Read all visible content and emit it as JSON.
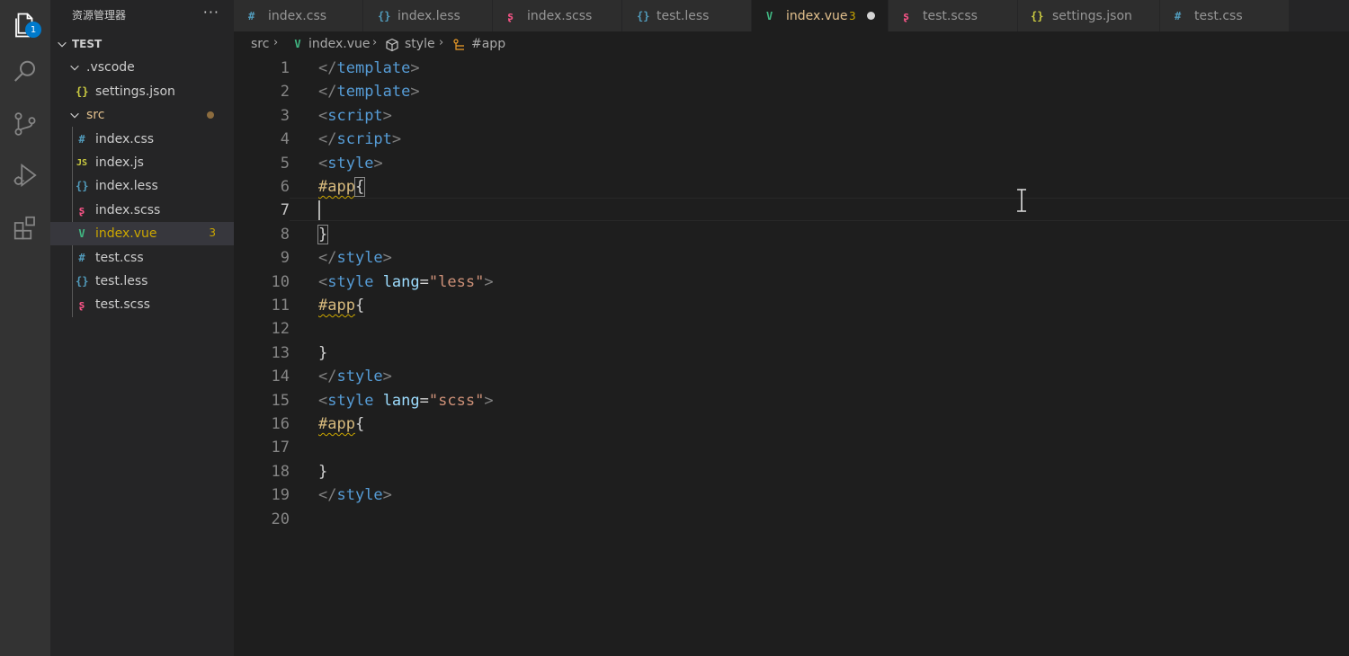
{
  "activity_bar": {
    "explorer_badge": "1",
    "items": [
      "explorer-icon",
      "search-icon",
      "source-control-icon",
      "run-debug-icon",
      "extensions-icon"
    ]
  },
  "sidebar": {
    "title": "资源管理器",
    "more": "···",
    "root": "TEST",
    "tree": [
      {
        "label": ".vscode",
        "icon": "",
        "kind": "folder"
      },
      {
        "label": "settings.json",
        "icon": "{}",
        "kind": "file"
      },
      {
        "label": "src",
        "icon": "",
        "kind": "folder"
      },
      {
        "label": "index.css",
        "icon": "#",
        "kind": "file"
      },
      {
        "label": "index.js",
        "icon": "JS",
        "kind": "file"
      },
      {
        "label": "index.less",
        "icon": "{}",
        "kind": "file"
      },
      {
        "label": "index.scss",
        "icon": "ʂ",
        "kind": "file"
      },
      {
        "label": "index.vue",
        "icon": "V",
        "kind": "file",
        "problems": "3"
      },
      {
        "label": "test.css",
        "icon": "#",
        "kind": "file"
      },
      {
        "label": "test.less",
        "icon": "{}",
        "kind": "file"
      },
      {
        "label": "test.scss",
        "icon": "ʂ",
        "kind": "file"
      }
    ]
  },
  "tabs": [
    {
      "label": "index.css",
      "icon": "#"
    },
    {
      "label": "index.less",
      "icon": "{}"
    },
    {
      "label": "index.scss",
      "icon": "ʂ"
    },
    {
      "label": "test.less",
      "icon": "{}"
    },
    {
      "label": "index.vue",
      "icon": "V",
      "problems": "3",
      "active": true
    },
    {
      "label": "test.scss",
      "icon": "ʂ"
    },
    {
      "label": "settings.json",
      "icon": "{}"
    },
    {
      "label": "test.css",
      "icon": "#"
    }
  ],
  "breadcrumb": [
    "src",
    "index.vue",
    "style",
    "#app"
  ],
  "editor": {
    "line_numbers": [
      "1",
      "2",
      "3",
      "4",
      "5",
      "6",
      "7",
      "8",
      "9",
      "10",
      "11",
      "12",
      "13",
      "14",
      "15",
      "16",
      "17",
      "18",
      "19",
      "20"
    ],
    "lines": [
      [
        [
          "</",
          "br"
        ],
        [
          "template",
          "tag"
        ],
        [
          ">",
          "br"
        ]
      ],
      [
        [
          "</",
          "br"
        ],
        [
          "template",
          "tag"
        ],
        [
          ">",
          "br"
        ]
      ],
      [
        [
          "<",
          "br"
        ],
        [
          "script",
          "tag"
        ],
        [
          ">",
          "br"
        ]
      ],
      [
        [
          "</",
          "br"
        ],
        [
          "script",
          "tag"
        ],
        [
          ">",
          "br"
        ]
      ],
      [
        [
          "<",
          "br"
        ],
        [
          "style",
          "tag"
        ],
        [
          ">",
          "br"
        ]
      ],
      [
        [
          "#app",
          "sel-sq"
        ],
        [
          "{",
          "pun-box"
        ]
      ],
      [],
      [
        [
          "}",
          "pun-box"
        ]
      ],
      [
        [
          "</",
          "br"
        ],
        [
          "style",
          "tag"
        ],
        [
          ">",
          "br"
        ]
      ],
      [
        [
          "<",
          "br"
        ],
        [
          "style",
          "tag"
        ],
        [
          " ",
          "pun"
        ],
        [
          "lang",
          "attr"
        ],
        [
          "=",
          "pun"
        ],
        [
          "\"less\"",
          "str"
        ],
        [
          ">",
          "br"
        ]
      ],
      [
        [
          "#app",
          "sel-sq"
        ],
        [
          "{",
          "pun"
        ]
      ],
      [],
      [
        [
          "}",
          "pun"
        ]
      ],
      [
        [
          "</",
          "br"
        ],
        [
          "style",
          "tag"
        ],
        [
          ">",
          "br"
        ]
      ],
      [
        [
          "<",
          "br"
        ],
        [
          "style",
          "tag"
        ],
        [
          " ",
          "pun"
        ],
        [
          "lang",
          "attr"
        ],
        [
          "=",
          "pun"
        ],
        [
          "\"scss\"",
          "str"
        ],
        [
          ">",
          "br"
        ]
      ],
      [
        [
          "#app",
          "sel-sq"
        ],
        [
          "{",
          "pun"
        ]
      ],
      [],
      [
        [
          "}",
          "pun"
        ]
      ],
      [
        [
          "</",
          "br"
        ],
        [
          "style",
          "tag"
        ],
        [
          ">",
          "br"
        ]
      ],
      []
    ]
  },
  "colors": {
    "tag": "#569cd6",
    "attr": "#9cdcfe",
    "string": "#ce9178",
    "selector": "#d7ba7d",
    "warning": "#cca700",
    "accent": "#007acc",
    "vue_green": "#41b883",
    "scss_pink": "#f55385",
    "json_yellow": "#cbcb41",
    "css_blue": "#519aba",
    "js_yellow": "#cbcb41"
  }
}
